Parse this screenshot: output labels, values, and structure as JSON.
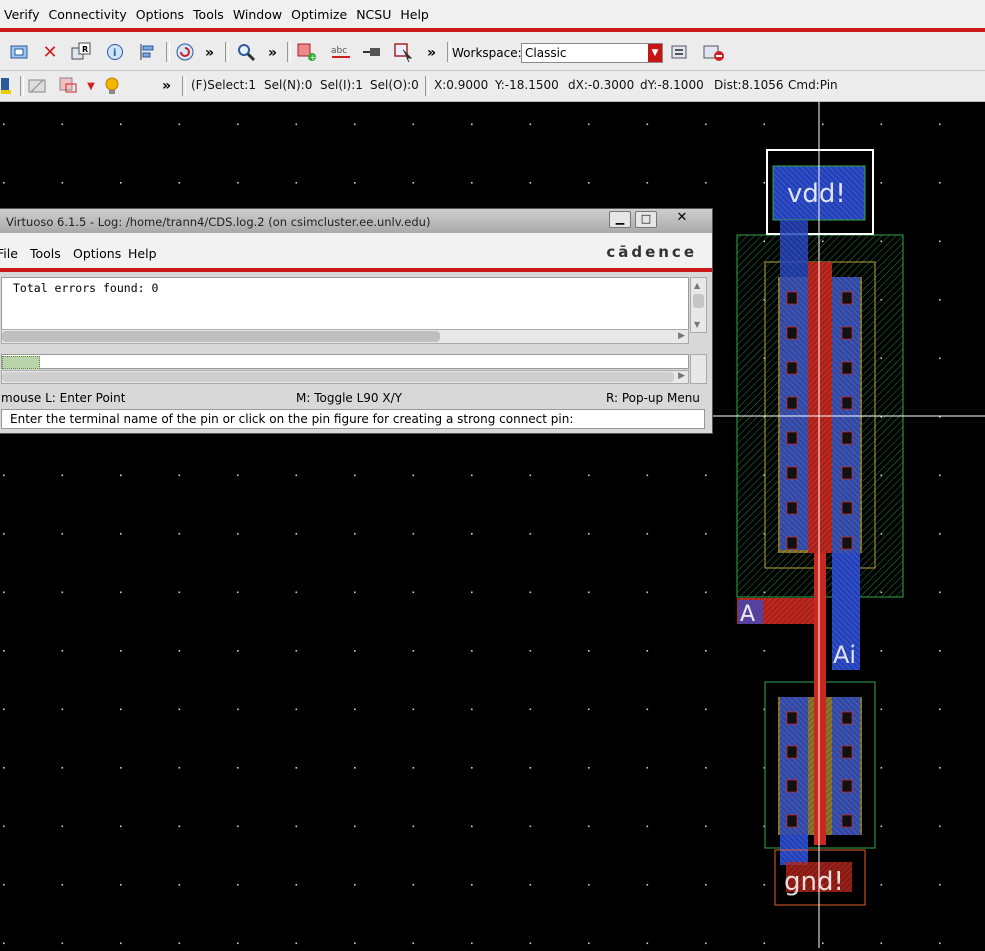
{
  "menubar": [
    "Verify",
    "Connectivity",
    "Options",
    "Tools",
    "Window",
    "Optimize",
    "NCSU",
    "Help"
  ],
  "toolbar": {
    "workspace_label": "Workspace:",
    "workspace_value": "Classic",
    "more": "»"
  },
  "status": {
    "select_filter": "(F)Select:1",
    "sel_n": "Sel(N):0",
    "sel_i": "Sel(I):1",
    "sel_o": "Sel(O):0",
    "x": "X:0.9000",
    "y": "Y:-18.1500",
    "dx": "dX:-0.3000",
    "dy": "dY:-8.1000",
    "dist": "Dist:8.1056",
    "cmd": "Cmd:Pin"
  },
  "log_window": {
    "title": "Virtuoso 6.1.5 - Log: /home/trann4/CDS.log.2 (on csimcluster.ee.unlv.edu)",
    "menu": [
      "File",
      "Tools",
      "Options",
      "Help"
    ],
    "brand": "cādence",
    "log_text": "Total errors found: 0",
    "mouse_left": "mouse L: Enter Point",
    "mouse_middle": "M: Toggle L90 X/Y",
    "mouse_right": "R: Pop-up Menu",
    "prompt": "Enter the terminal name of the pin or click on the pin figure for creating a strong connect pin:"
  },
  "layout": {
    "labels": {
      "vdd": "vdd!",
      "gnd": "gnd!",
      "input": "A",
      "input_label": "Ai"
    }
  },
  "colors": {
    "menu_accent": "#cc1a1a",
    "canvas_bg": "#000000",
    "poly": "#d82a1e",
    "metal1": "#2d4fd6",
    "nwell": "#2fa84a",
    "active": "#b9a33a",
    "contact": "#111111"
  }
}
